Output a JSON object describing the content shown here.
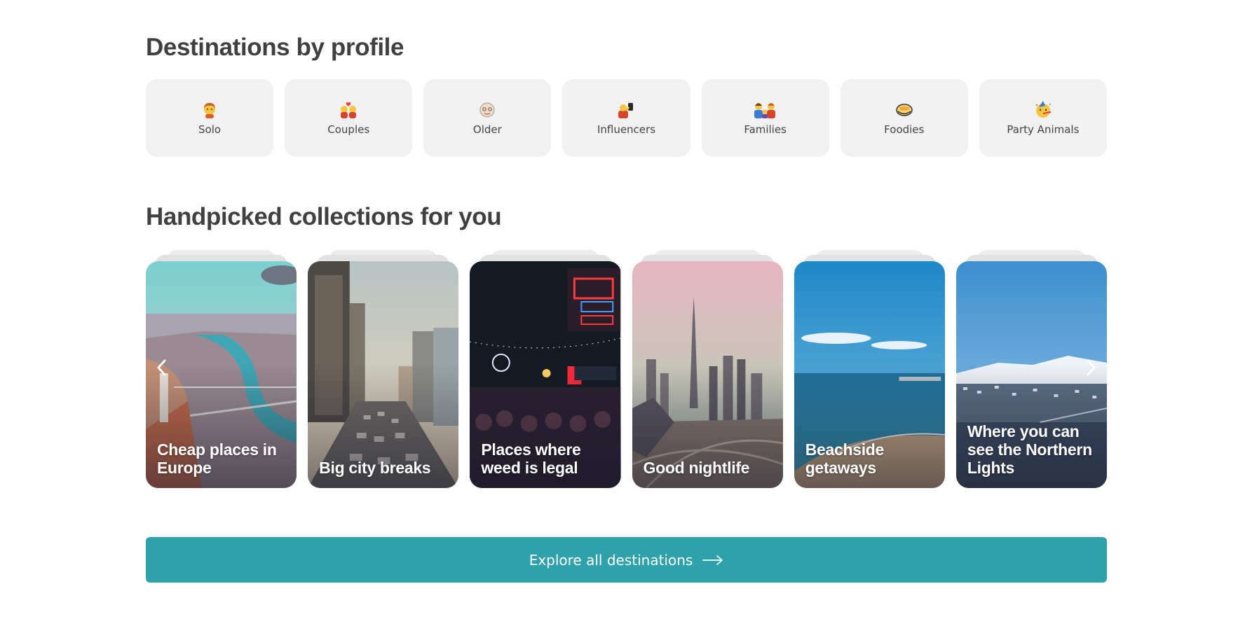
{
  "sections": {
    "profiles_title": "Destinations by profile",
    "collections_title": "Handpicked collections for you"
  },
  "profiles": [
    {
      "label": "Solo",
      "icon": "solo-person-emoji-icon"
    },
    {
      "label": "Couples",
      "icon": "couple-heart-emoji-icon"
    },
    {
      "label": "Older",
      "icon": "older-person-emoji-icon"
    },
    {
      "label": "Influencers",
      "icon": "selfie-emoji-icon"
    },
    {
      "label": "Families",
      "icon": "family-emoji-icon"
    },
    {
      "label": "Foodies",
      "icon": "food-bowl-emoji-icon"
    },
    {
      "label": "Party Animals",
      "icon": "party-face-emoji-icon"
    }
  ],
  "collections": [
    {
      "title": "Cheap places in Europe",
      "scene": "river-city"
    },
    {
      "title": "Big city breaks",
      "scene": "city-street"
    },
    {
      "title": "Places where weed is legal",
      "scene": "neon-night"
    },
    {
      "title": "Good nightlife",
      "scene": "skyline-tower"
    },
    {
      "title": "Beachside getaways",
      "scene": "beach"
    },
    {
      "title": "Where you can see the Northern Lights",
      "scene": "snowy-harbor"
    }
  ],
  "carousel": {
    "prev_icon": "chevron-left-icon",
    "next_icon": "chevron-right-icon"
  },
  "cta": {
    "label": "Explore all destinations",
    "icon": "arrow-right-icon"
  },
  "colors": {
    "accent": "#2fa1ab",
    "tile_bg": "#f1f1f1",
    "heading": "#404040"
  }
}
